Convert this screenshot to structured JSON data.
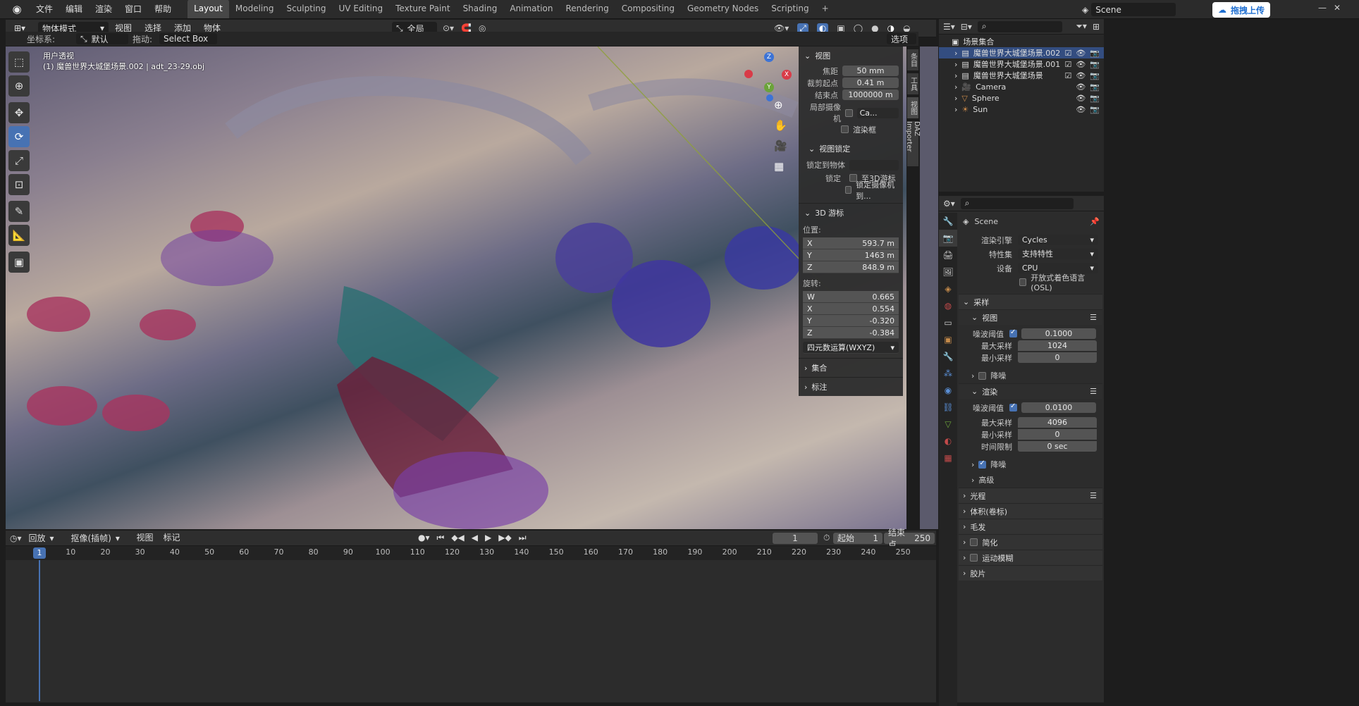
{
  "topbar": {
    "menus": [
      "文件",
      "编辑",
      "渲染",
      "窗口",
      "帮助"
    ],
    "tabs": [
      "Layout",
      "Modeling",
      "Sculpting",
      "UV Editing",
      "Texture Paint",
      "Shading",
      "Animation",
      "Rendering",
      "Compositing",
      "Geometry Nodes",
      "Scripting"
    ],
    "active_tab": "Layout",
    "plus": "+",
    "scene": "Scene",
    "upload_btn": "拖拽上传"
  },
  "header": {
    "mode": "物体模式",
    "menus": [
      "视图",
      "选择",
      "添加",
      "物体"
    ],
    "transform_orient": "全局"
  },
  "subheader": {
    "coord_label": "坐标系:",
    "coord_value": "默认",
    "drag_label": "拖动:",
    "drag_value": "Select Box",
    "options": "选项"
  },
  "viewport": {
    "view_name": "用户透视",
    "object_info": "(1) 魔兽世界大城堡场景.002 | adt_23-29.obj"
  },
  "npanel": {
    "view_header": "视图",
    "focal_label": "焦距",
    "focal": "50 mm",
    "clip_start_label": "裁剪起点",
    "clip_start": "0.41 m",
    "clip_end_label": "结束点",
    "clip_end": "1000000 m",
    "local_cam_label": "局部摄像机",
    "local_cam_value": "Ca...",
    "render_border": "渲染框",
    "view_lock_header": "视图锁定",
    "lock_obj_label": "锁定到物体",
    "lock_label": "锁定",
    "lock_3d_cursor": "至3D游标",
    "lock_cam": "锁定摄像机到...",
    "cursor_header": "3D 游标",
    "location_label": "位置:",
    "loc": [
      {
        "axis": "X",
        "val": "593.7 m"
      },
      {
        "axis": "Y",
        "val": "1463 m"
      },
      {
        "axis": "Z",
        "val": "848.9 m"
      }
    ],
    "rotation_label": "旋转:",
    "rot": [
      {
        "axis": "W",
        "val": "0.665"
      },
      {
        "axis": "X",
        "val": "0.554"
      },
      {
        "axis": "Y",
        "val": "-0.320"
      },
      {
        "axis": "Z",
        "val": "-0.384"
      }
    ],
    "rot_mode": "四元数运算(WXYZ)",
    "collection": "集合",
    "annotation": "标注"
  },
  "sidetabs": [
    "条目",
    "工具",
    "视图",
    "DAZ Importer"
  ],
  "outliner": {
    "root": "场景集合",
    "items": [
      {
        "name": "魔兽世界大城堡场景.002"
      },
      {
        "name": "魔兽世界大城堡场景.001"
      },
      {
        "name": "魔兽世界大城堡场景"
      },
      {
        "name": "Camera"
      },
      {
        "name": "Sphere"
      },
      {
        "name": "Sun"
      }
    ]
  },
  "props": {
    "scene": "Scene",
    "engine_label": "渲染引擎",
    "engine": "Cycles",
    "feature_label": "特性集",
    "feature": "支持特性",
    "device_label": "设备",
    "device": "CPU",
    "osl": "开放式着色语言 (OSL)",
    "sampling": "采样",
    "viewport_sub": "视图",
    "noise_label": "噪波阈值",
    "v_noise": "0.1000",
    "max_label": "最大采样",
    "v_max": "1024",
    "min_label": "最小采样",
    "v_min": "0",
    "denoise": "降噪",
    "render_sub": "渲染",
    "r_noise": "0.0100",
    "r_max": "4096",
    "r_min": "0",
    "time_label": "时间限制",
    "r_time": "0 sec",
    "advanced": "高级",
    "light_paths": "光程",
    "volumes": "体积(卷标)",
    "hair": "毛发",
    "simplify": "简化",
    "motion_blur": "运动模糊",
    "film": "胶片"
  },
  "timeline": {
    "menus": [
      "回放",
      "抠像(插帧)",
      "视图",
      "标记"
    ],
    "current": "1",
    "start_label": "起始",
    "start": "1",
    "end_label": "结束点",
    "end": "250",
    "ticks": [
      "1",
      "10",
      "20",
      "30",
      "40",
      "50",
      "60",
      "70",
      "80",
      "90",
      "100",
      "110",
      "120",
      "130",
      "140",
      "150",
      "160",
      "170",
      "180",
      "190",
      "200",
      "210",
      "220",
      "230",
      "240",
      "250"
    ]
  }
}
